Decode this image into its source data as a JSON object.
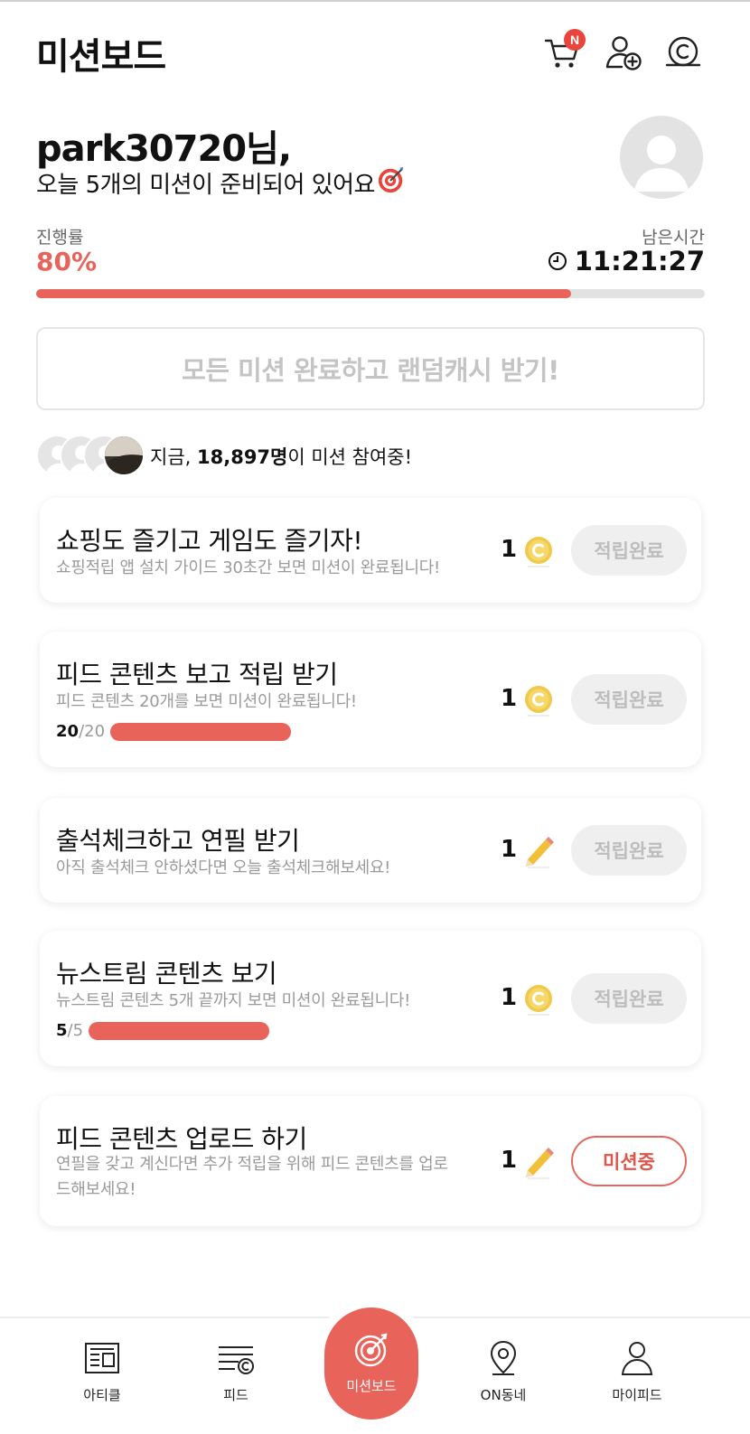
{
  "header": {
    "title": "미션보드",
    "cart_badge": "N"
  },
  "greeting": {
    "name": "park30720님,",
    "subtitle": "오늘 5개의 미션이 준비되어 있어요",
    "subtitle_emoji": "🎯"
  },
  "progress": {
    "label": "진행률",
    "value_text": "80%",
    "fraction": 0.8,
    "remain_label": "남은시간",
    "remain_time": "11:21:27"
  },
  "reward_banner": "모든 미션 완료하고 랜덤캐시 받기!",
  "participants": {
    "prefix": "지금, ",
    "count": "18,897명",
    "suffix": "이 미션 참여중!"
  },
  "missions": [
    {
      "title": "쇼핑도 즐기고 게임도 즐기자!",
      "desc": "쇼핑적립 앱 설치 가이드 30초간 보면 미션이 완료됩니다!",
      "reward": "1",
      "reward_type": "coin-icon",
      "status": "적립완료"
    },
    {
      "title": "피드 콘텐츠 보고 적립 받기",
      "desc": "피드 콘텐츠 20개를 보면 미션이 완료됩니다!",
      "progress_cur": "20",
      "progress_total": "/20",
      "reward": "1",
      "reward_type": "coin-icon",
      "status": "적립완료"
    },
    {
      "title": "출석체크하고 연필 받기",
      "desc": "아직 출석체크 안하셨다면 오늘 출석체크해보세요!",
      "reward": "1",
      "reward_type": "pencil-icon",
      "status": "적립완료"
    },
    {
      "title": "뉴스트림 콘텐츠 보기",
      "desc": "뉴스트림 콘텐츠 5개 끝까지 보면 미션이 완료됩니다!",
      "progress_cur": "5",
      "progress_total": "/5",
      "reward": "1",
      "reward_type": "coin-icon",
      "status": "적립완료"
    },
    {
      "title": "피드 콘텐츠 업로드 하기",
      "desc": "연필을 갖고 계신다면 추가 적립을 위해 피드 콘텐츠를 업로드해보세요!",
      "reward": "1",
      "reward_type": "pencil-icon",
      "status": "미션중"
    }
  ],
  "nav": [
    {
      "label": "아티클",
      "icon": "article-icon"
    },
    {
      "label": "피드",
      "icon": "feed-icon"
    },
    {
      "label": "미션보드",
      "icon": "target-icon"
    },
    {
      "label": "ON동네",
      "icon": "location-pin-icon"
    },
    {
      "label": "마이피드",
      "icon": "person-icon"
    }
  ],
  "colors": {
    "accent": "#e8645a",
    "muted_text": "#9a9a9a",
    "disabled_button": "#efefef"
  }
}
